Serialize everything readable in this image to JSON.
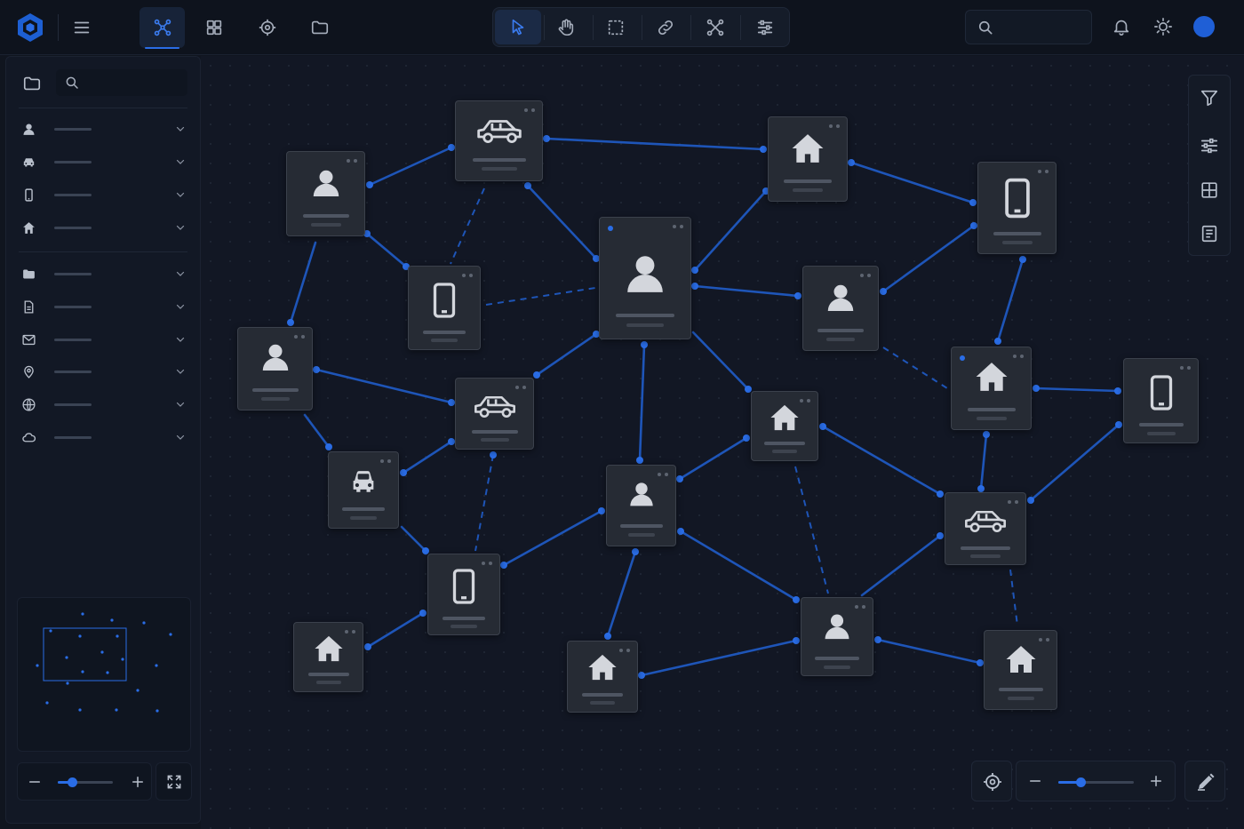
{
  "app": {
    "accent": "#2a6de6"
  },
  "header": {
    "menu_icon": "hamburger-icon",
    "tabs": [
      {
        "name": "graph-view-tab",
        "icon": "graph-icon",
        "active": true
      },
      {
        "name": "grid-view-tab",
        "icon": "grid-icon",
        "active": false
      },
      {
        "name": "target-view-tab",
        "icon": "crosshair-icon",
        "active": false
      },
      {
        "name": "folder-view-tab",
        "icon": "folder-icon",
        "active": false
      }
    ],
    "tools": [
      {
        "name": "select-tool",
        "icon": "pointer-icon",
        "active": true
      },
      {
        "name": "pan-tool",
        "icon": "hand-icon",
        "active": false
      },
      {
        "name": "marquee-tool",
        "icon": "marquee-icon",
        "active": false
      },
      {
        "name": "link-tool",
        "icon": "link-icon",
        "active": false
      },
      {
        "name": "layout-tool",
        "icon": "network-icon",
        "active": false
      },
      {
        "name": "adjust-tool",
        "icon": "sliders-icon",
        "active": false
      }
    ],
    "search": {
      "placeholder": ""
    },
    "right_icons": [
      "bell-icon",
      "sun-icon",
      "avatar"
    ]
  },
  "sidebar": {
    "search": {
      "placeholder": ""
    },
    "groups": [
      [
        "person-icon",
        "car-icon",
        "phone-icon",
        "home-icon"
      ],
      [
        "folder-icon",
        "document-icon",
        "mail-icon",
        "location-pin-icon",
        "globe-icon",
        "cloud-icon"
      ]
    ]
  },
  "graph": {
    "node_types": [
      "person",
      "car",
      "phone",
      "home"
    ]
  },
  "right_panel": [
    "filter-icon",
    "sliders-icon",
    "grid-icon",
    "notes-icon"
  ],
  "zoom": {
    "level": 0.3
  }
}
